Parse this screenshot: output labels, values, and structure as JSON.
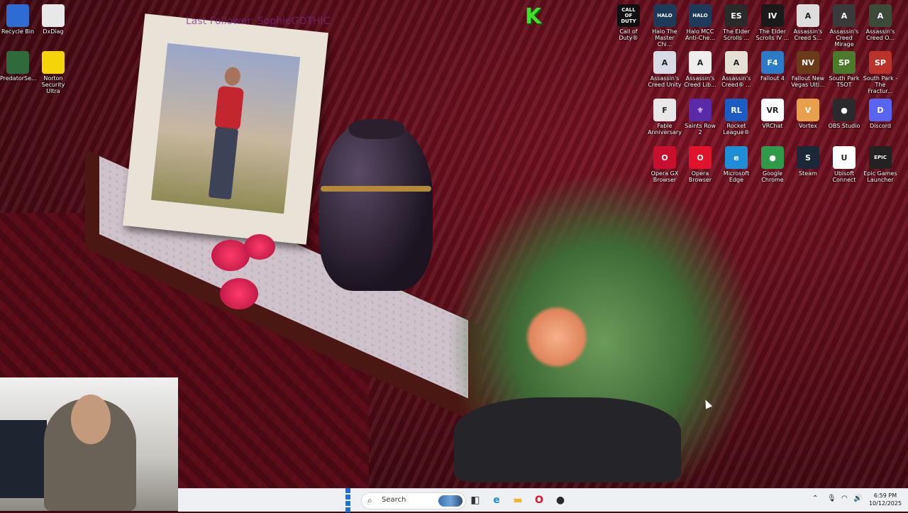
{
  "overlay": {
    "followers_text": "Last Follower: SophieGOTHIC",
    "logo": "K"
  },
  "desktop_icons_left": [
    {
      "label": "Recycle Bin",
      "icon": "recycle-bin-icon",
      "color": "#2e6bd3"
    },
    {
      "label": "DxDiag",
      "icon": "document-icon",
      "color": "#e8e8e8"
    },
    {
      "label": "PredatorSe...",
      "icon": "predator-sense-icon",
      "color": "#2f6b3a"
    },
    {
      "label": "Norton Security Ultra",
      "icon": "norton-icon",
      "color": "#f5d50a"
    }
  ],
  "desktop_icons_right": [
    {
      "label": "Call of Duty®",
      "icon": "call-of-duty-icon",
      "color": "#111111",
      "text": "CALL OF DUTY"
    },
    {
      "label": "Halo The Master Chi...",
      "icon": "halo-mcc-icon",
      "color": "#1d3a5a",
      "text": "HALO"
    },
    {
      "label": "Halo MCC Anti-Che...",
      "icon": "halo-anticheat-icon",
      "color": "#1d3a5a",
      "text": "HALO"
    },
    {
      "label": "The Elder Scrolls ...",
      "icon": "elder-scrolls-icon",
      "color": "#2a2a2a",
      "text": "ES"
    },
    {
      "label": "The Elder Scrolls IV ...",
      "icon": "oblivion-icon",
      "color": "#1a1a1a",
      "text": "IV"
    },
    {
      "label": "Assassin's Creed S...",
      "icon": "assassins-creed-icon",
      "color": "#dddddd",
      "text": "A"
    },
    {
      "label": "Assassin's Creed Mirage",
      "icon": "ac-mirage-icon",
      "color": "#3a3a3a",
      "text": "A"
    },
    {
      "label": "Assassin's Creed O...",
      "icon": "ac-origins-icon",
      "color": "#3c4a3a",
      "text": "A"
    },
    {
      "label": "Assassin's Creed Unity",
      "icon": "ac-unity-icon",
      "color": "#d8dbe6",
      "text": "A"
    },
    {
      "label": "Assassin's Creed Lib...",
      "icon": "ac-liberation-icon",
      "color": "#eeeeee",
      "text": "A"
    },
    {
      "label": "Assassin's Creed® ...",
      "icon": "ac-iii-icon",
      "color": "#e4e0d6",
      "text": "A"
    },
    {
      "label": "Fallout 4",
      "icon": "fallout4-icon",
      "color": "#2b7bc8",
      "text": "F4"
    },
    {
      "label": "Fallout New Vegas Ulti...",
      "icon": "fallout-nv-icon",
      "color": "#6b3a1a",
      "text": "NV"
    },
    {
      "label": "South Park TSOT",
      "icon": "south-park-tsot-icon",
      "color": "#4a7a2a",
      "text": "SP"
    },
    {
      "label": "South Park - The Fractur...",
      "icon": "south-park-tfbw-icon",
      "color": "#b8332a",
      "text": "SP"
    },
    {
      "label": "Fable Anniversary",
      "icon": "fable-icon",
      "color": "#e8e8e8",
      "text": "F"
    },
    {
      "label": "Saints Row 2",
      "icon": "saints-row-icon",
      "color": "#5a2aa8",
      "text": "⚜"
    },
    {
      "label": "Rocket League®",
      "icon": "rocket-league-icon",
      "color": "#1b5dc4",
      "text": "RL"
    },
    {
      "label": "VRChat",
      "icon": "vrchat-icon",
      "color": "#ffffff",
      "text": "VR"
    },
    {
      "label": "Vortex",
      "icon": "vortex-icon",
      "color": "#e8a04a",
      "text": "V"
    },
    {
      "label": "OBS Studio",
      "icon": "obs-studio-icon",
      "color": "#2a2a2e",
      "text": "●"
    },
    {
      "label": "Discord",
      "icon": "discord-icon",
      "color": "#5865f2",
      "text": "D"
    },
    {
      "label": "Opera GX Browser",
      "icon": "opera-gx-icon",
      "color": "#c8102e",
      "text": "O"
    },
    {
      "label": "Opera Browser",
      "icon": "opera-icon",
      "color": "#e0132b",
      "text": "O"
    },
    {
      "label": "Microsoft Edge",
      "icon": "edge-icon",
      "color": "#1e8fd6",
      "text": "e"
    },
    {
      "label": "Google Chrome",
      "icon": "chrome-icon",
      "color": "#2f9a4a",
      "text": "●"
    },
    {
      "label": "Steam",
      "icon": "steam-icon",
      "color": "#1b2838",
      "text": "S"
    },
    {
      "label": "Ubisoft Connect",
      "icon": "ubisoft-connect-icon",
      "color": "#ffffff",
      "text": "U"
    },
    {
      "label": "Epic Games Launcher",
      "icon": "epic-games-icon",
      "color": "#222222",
      "text": "EPIC"
    }
  ],
  "taskbar": {
    "search_placeholder": "Search",
    "clock_time": "6:59 PM",
    "clock_date": "10/12/2025",
    "pinned": [
      {
        "name": "task-view-icon",
        "color": "#333333",
        "glyph": "◧"
      },
      {
        "name": "edge-taskbar-icon",
        "color": "#1e8fd6",
        "glyph": "e"
      },
      {
        "name": "file-explorer-icon",
        "color": "#f2b52a",
        "glyph": "▬"
      },
      {
        "name": "opera-taskbar-icon",
        "color": "#e0132b",
        "glyph": "O"
      },
      {
        "name": "obs-taskbar-icon",
        "color": "#2a2a2e",
        "glyph": "●"
      }
    ],
    "tray": [
      {
        "name": "chevron-up-icon",
        "glyph": "⌃"
      },
      {
        "name": "microphone-icon",
        "glyph": "🎙"
      },
      {
        "name": "wifi-icon",
        "glyph": "◠"
      },
      {
        "name": "volume-icon",
        "glyph": "🔊"
      },
      {
        "name": "battery-icon",
        "glyph": "▭"
      }
    ]
  }
}
